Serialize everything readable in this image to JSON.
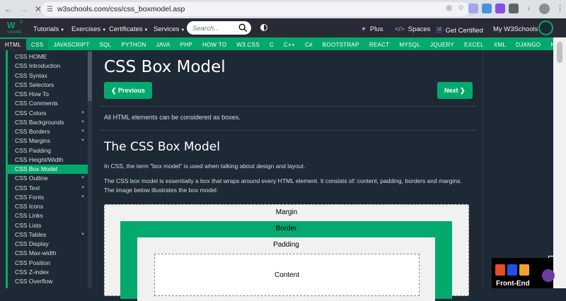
{
  "browser": {
    "url": "w3schools.com/css/css_boxmodel.asp"
  },
  "logo": {
    "main": "W",
    "sup": "3",
    "sub": "schools"
  },
  "topnav": {
    "tutorials": "Tutorials",
    "exercises": "Exercises",
    "certificates": "Certificates",
    "services": "Services",
    "search_placeholder": "Search...",
    "plus": "Plus",
    "spaces": "Spaces",
    "certified": "Get Certified",
    "my": "My W3Schools"
  },
  "subnav": [
    "HTML",
    "CSS",
    "JAVASCRIPT",
    "SQL",
    "PYTHON",
    "JAVA",
    "PHP",
    "HOW TO",
    "W3.CSS",
    "C",
    "C++",
    "C#",
    "BOOTSTRAP",
    "REACT",
    "MYSQL",
    "JQUERY",
    "EXCEL",
    "XML",
    "DJANGO",
    "NUMPY"
  ],
  "sidebar": [
    {
      "label": "CSS HOME"
    },
    {
      "label": "CSS Introduction"
    },
    {
      "label": "CSS Syntax"
    },
    {
      "label": "CSS Selectors"
    },
    {
      "label": "CSS How To"
    },
    {
      "label": "CSS Comments"
    },
    {
      "label": "CSS Colors",
      "expand": true
    },
    {
      "label": "CSS Backgrounds",
      "expand": true
    },
    {
      "label": "CSS Borders",
      "expand": true
    },
    {
      "label": "CSS Margins",
      "expand": true
    },
    {
      "label": "CSS Padding"
    },
    {
      "label": "CSS Height/Width"
    },
    {
      "label": "CSS Box Model",
      "active": true
    },
    {
      "label": "CSS Outline",
      "expand": true
    },
    {
      "label": "CSS Text",
      "expand": true
    },
    {
      "label": "CSS Fonts",
      "expand": true
    },
    {
      "label": "CSS Icons"
    },
    {
      "label": "CSS Links"
    },
    {
      "label": "CSS Lists"
    },
    {
      "label": "CSS Tables",
      "expand": true
    },
    {
      "label": "CSS Display"
    },
    {
      "label": "CSS Max-width"
    },
    {
      "label": "CSS Position"
    },
    {
      "label": "CSS Z-index"
    },
    {
      "label": "CSS Overflow"
    }
  ],
  "main": {
    "title": "CSS Box Model",
    "prev": "❮ Previous",
    "next": "Next ❯",
    "intro": "All HTML elements can be considered as boxes.",
    "h2": "The CSS Box Model",
    "p1": "In CSS, the term \"box model\" is used when talking about design and layout.",
    "p2": "The CSS box model is essentially a box that wraps around every HTML element. It consists of: content, padding, borders and margins. The image below illustrates the box model:",
    "box": {
      "margin": "Margin",
      "border": "Border",
      "padding": "Padding",
      "content": "Content"
    }
  },
  "ad": {
    "text": "Front-End"
  },
  "colors": {
    "accent": "#04aa6d",
    "dark": "#1d2a35",
    "nav": "#282a35"
  }
}
